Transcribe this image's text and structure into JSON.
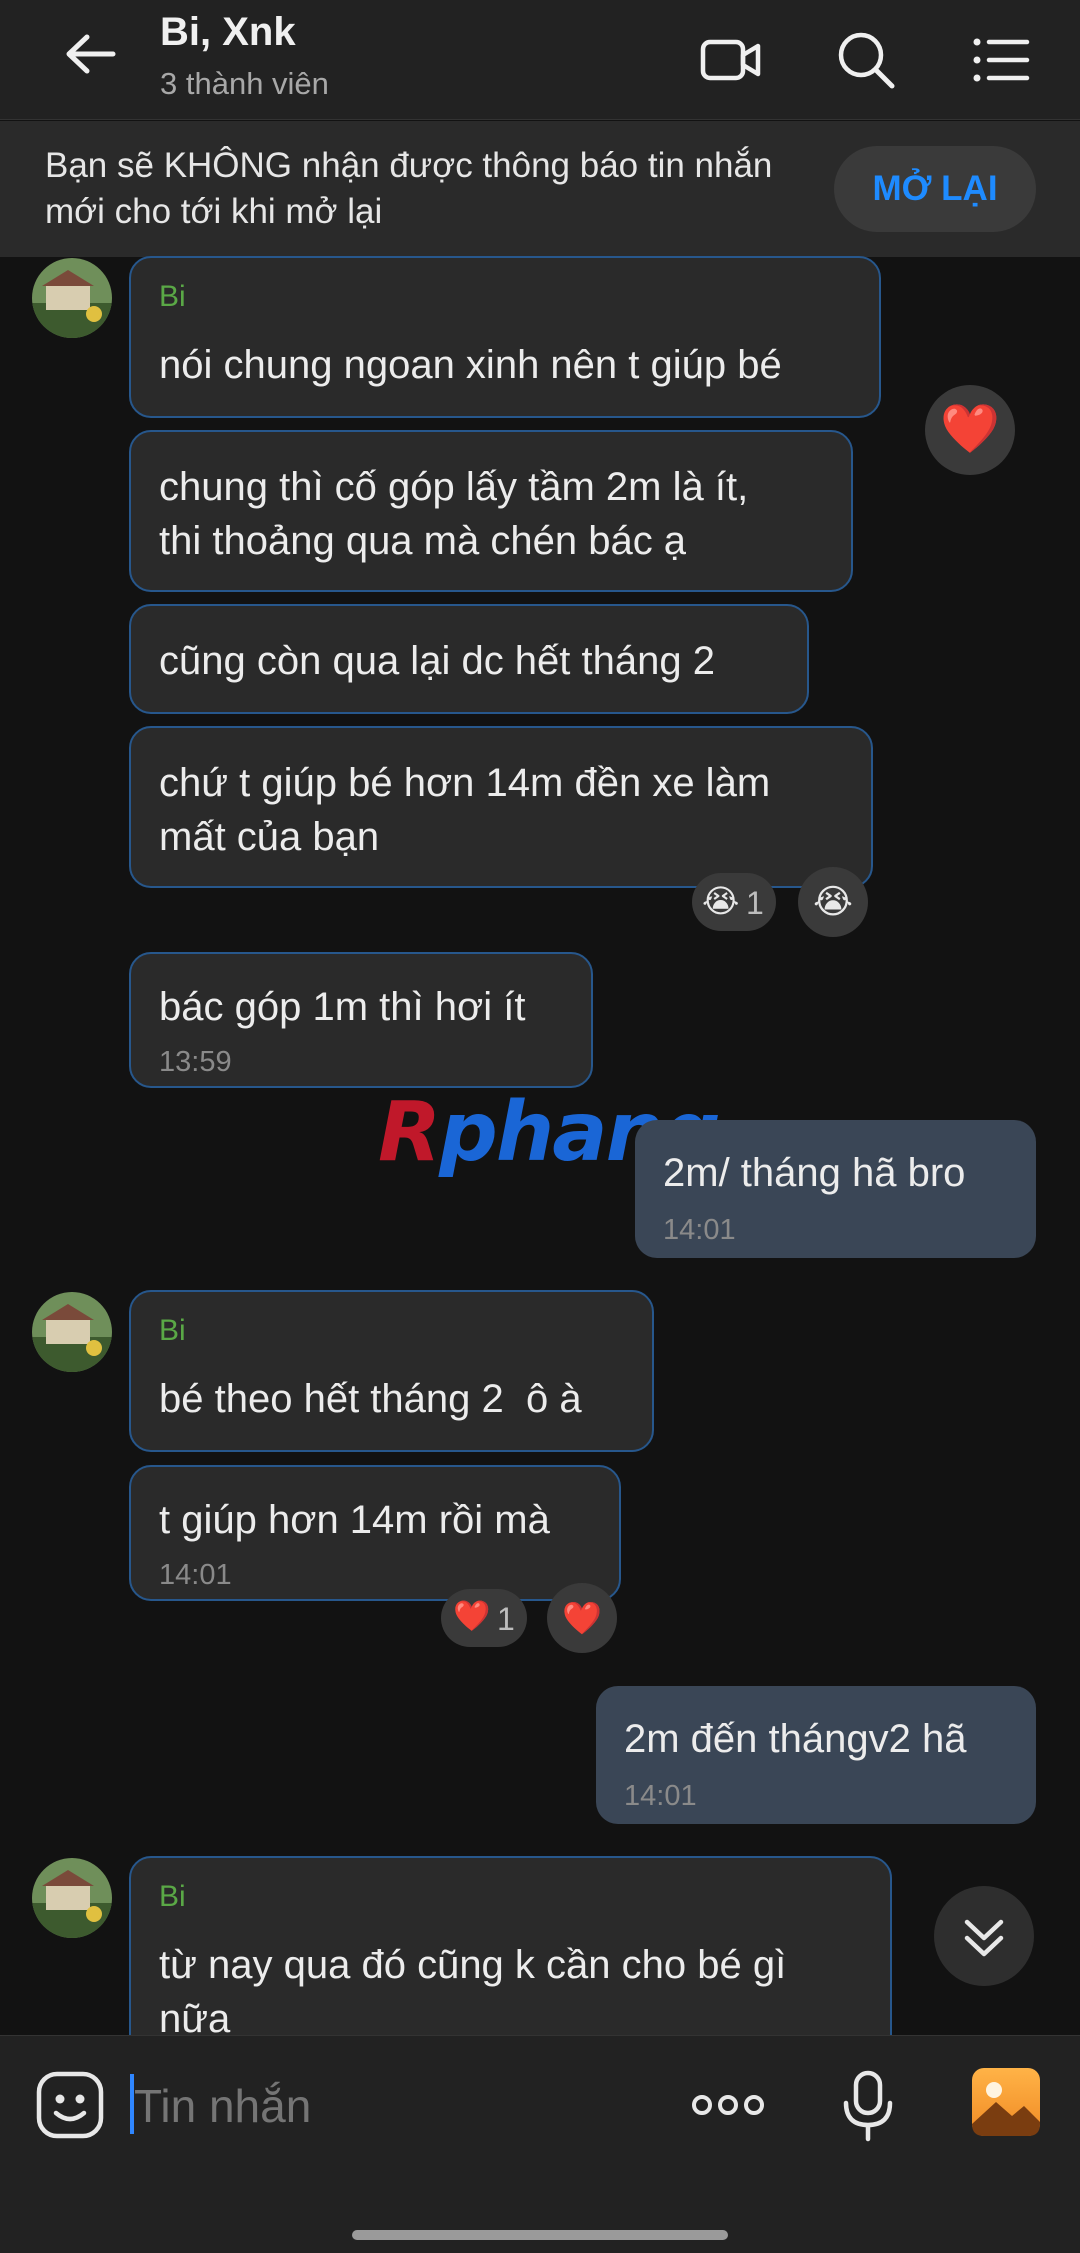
{
  "header": {
    "title": "Bi, Xnk",
    "subtitle": "3 thành viên",
    "icons": [
      "back-arrow-icon",
      "video-call-icon",
      "search-icon",
      "menu-list-icon"
    ]
  },
  "banner": {
    "text": "Bạn sẽ KHÔNG nhận được thông báo tin nhắn mới cho tới khi mở lại",
    "button": "MỞ LẠI"
  },
  "messages": {
    "m1": {
      "sender": "Bi",
      "text": "nói chung ngoan xinh nên t giúp bé",
      "reaction": "❤️"
    },
    "m2": {
      "text": "chung thì cố góp lấy tầm 2m là ít,\nthi thoảng qua mà chén bác ạ"
    },
    "m3": {
      "text": "cũng còn qua lại dc hết tháng 2"
    },
    "m4": {
      "text": "chứ t giúp bé hơn 14m đền xe làm\nmất của bạn",
      "reaction": "😭",
      "reaction_count": "1",
      "reaction_button": "😭"
    },
    "m5": {
      "text": "bác góp 1m thì hơi ít",
      "time": "13:59"
    },
    "m6": {
      "text": "2m/ tháng hã bro",
      "time": "14:01"
    },
    "m7": {
      "sender": "Bi",
      "text": "bé theo hết tháng 2  ô à"
    },
    "m8": {
      "text": "t giúp hơn 14m rồi mà",
      "time": "14:01",
      "reaction": "❤️",
      "reaction_count": "1",
      "reaction_button": "❤️"
    },
    "m9": {
      "text": "2m đến thángv2 hã",
      "time": "14:01"
    },
    "m10": {
      "sender": "Bi",
      "text": "từ nay qua đó cũng k cần cho bé gì\nnữa"
    }
  },
  "watermark": {
    "part1": "R",
    "part2": "phang",
    "color1": "#c0182a",
    "color2": "#1a66d6"
  },
  "composer": {
    "placeholder": "Tin nhắn",
    "icons": [
      "sticker-icon",
      "more-options-icon",
      "microphone-icon",
      "photo-gallery-icon"
    ]
  },
  "colors": {
    "accent": "#1e8bff",
    "sender": "#5aa846",
    "bubble_border": "#27578c",
    "mine_bubble": "#3a4656"
  }
}
